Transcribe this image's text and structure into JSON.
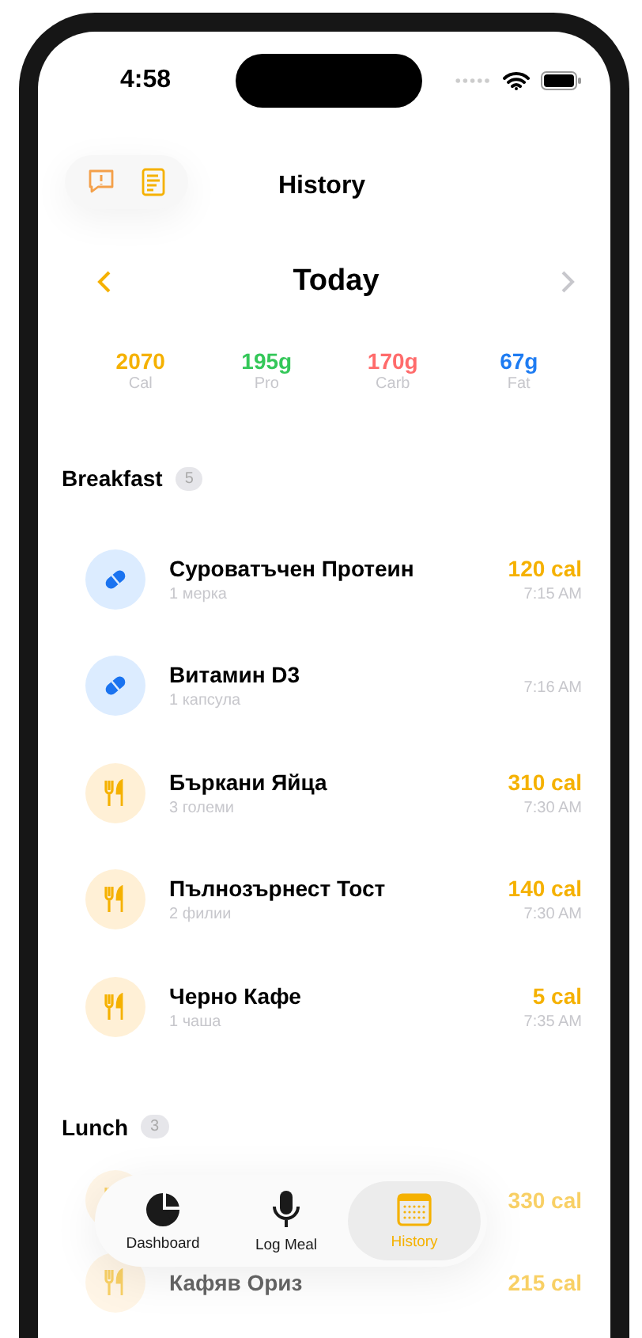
{
  "status_bar": {
    "time": "4:58"
  },
  "header": {
    "title": "History"
  },
  "date_nav": {
    "label": "Today",
    "prev_enabled": true,
    "next_enabled": false
  },
  "macros": [
    {
      "value": "2070",
      "label": "Cal",
      "color": "#f5b100"
    },
    {
      "value": "195g",
      "label": "Pro",
      "color": "#34c759"
    },
    {
      "value": "170g",
      "label": "Carb",
      "color": "#ff6b6b"
    },
    {
      "value": "67g",
      "label": "Fat",
      "color": "#1e7cf2"
    }
  ],
  "sections": [
    {
      "title": "Breakfast",
      "count": "5",
      "items": [
        {
          "kind": "supplement",
          "name": "Суроватъчен Протеин",
          "amount": "1 мерка",
          "calories": "120 cal",
          "time": "7:15 AM"
        },
        {
          "kind": "supplement",
          "name": "Витамин D3",
          "amount": "1 капсула",
          "time": "7:16 AM"
        },
        {
          "kind": "food",
          "name": "Бъркани Яйца",
          "amount": "3 големи",
          "calories": "310 cal",
          "time": "7:30 AM"
        },
        {
          "kind": "food",
          "name": "Пълнозърнест Тост",
          "amount": "2 филии",
          "calories": "140 cal",
          "time": "7:30 AM"
        },
        {
          "kind": "food",
          "name": "Черно Кафе",
          "amount": "1 чаша",
          "calories": "5 cal",
          "time": "7:35 AM"
        }
      ]
    },
    {
      "title": "Lunch",
      "count": "3",
      "items": [
        {
          "kind": "food",
          "calories": "330 cal"
        },
        {
          "kind": "food",
          "name": "Кафяв Ориз",
          "calories": "215 cal"
        }
      ]
    }
  ],
  "tab_bar": [
    {
      "kind": "dashboard",
      "label": "Dashboard",
      "selected": false
    },
    {
      "kind": "log",
      "label": "Log Meal",
      "selected": false
    },
    {
      "kind": "history",
      "label": "History",
      "selected": true
    }
  ]
}
